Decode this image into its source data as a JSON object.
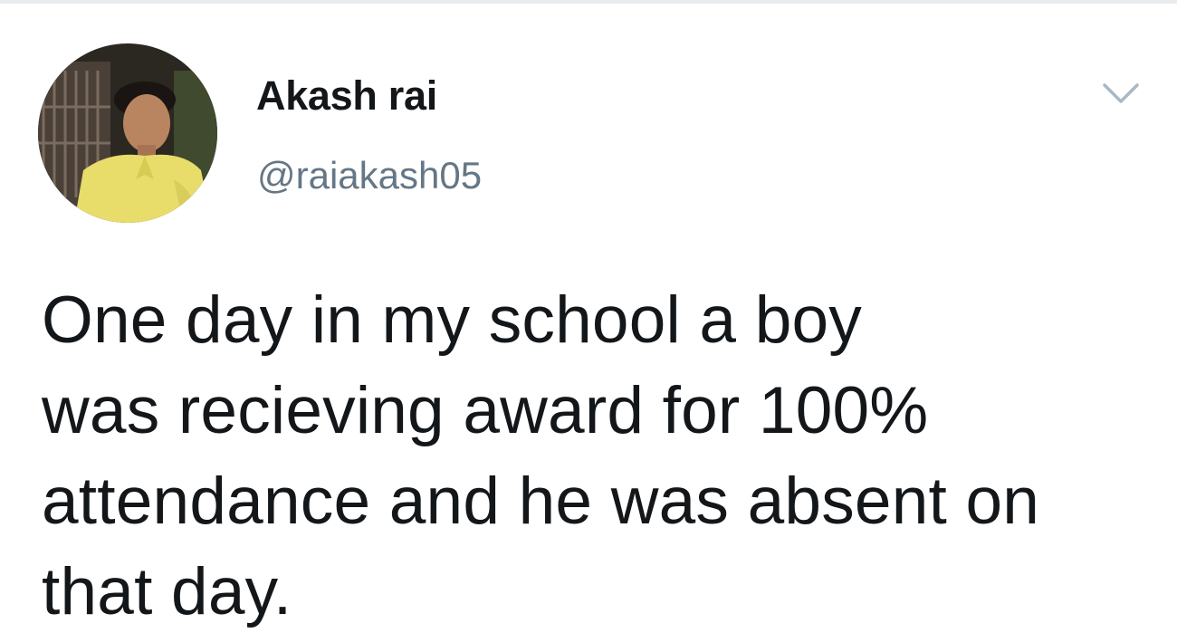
{
  "tweet": {
    "author": {
      "display_name": "Akash rai",
      "handle": "@raiakash05",
      "avatar_icon": "profile-photo"
    },
    "menu_icon": "chevron-down-icon",
    "text_lines": [
      "One day in my school a boy",
      "was recieving award for 100%",
      "attendance and he was absent on",
      "that day."
    ]
  },
  "colors": {
    "text_primary": "#14171a",
    "text_secondary": "#657786",
    "caret": "#aab8c2",
    "background": "#ffffff"
  }
}
